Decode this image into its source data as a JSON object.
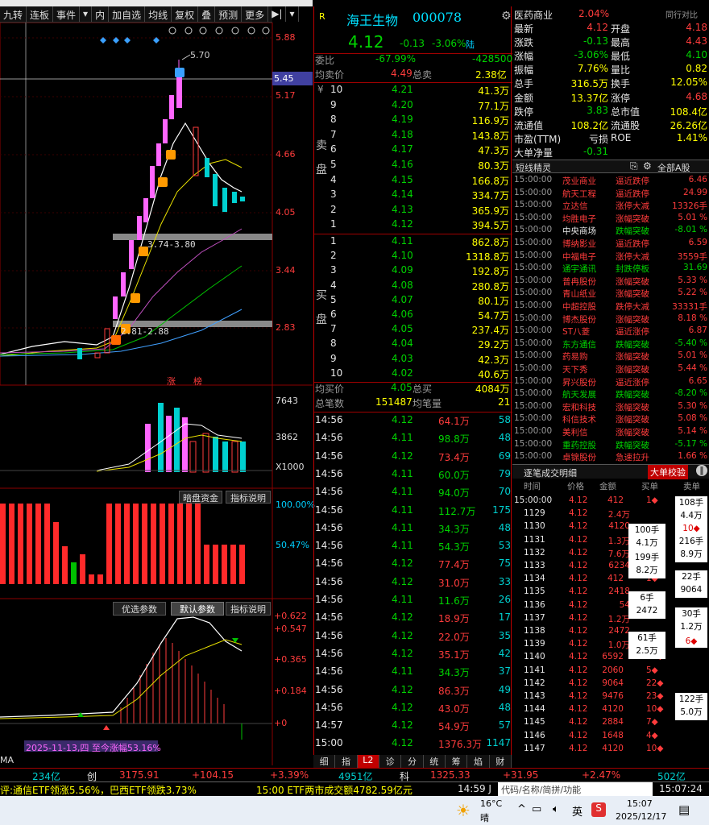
{
  "toolbar": {
    "items": [
      "九转",
      "连板",
      "事件",
      "▾",
      "内",
      "加自选",
      "均线",
      "复权",
      "叠",
      "预测",
      "更多",
      "▶|",
      "▾"
    ]
  },
  "chart": {
    "price_labels": [
      "5.88",
      "5.45",
      "5.17",
      "4.66",
      "4.05",
      "3.44",
      "2.83"
    ],
    "hi_marker": "5.70",
    "box1": "3.74-3.80",
    "box2": "2.81-2.88",
    "zt_labels": [
      "涨",
      "榜"
    ],
    "vol_labels": [
      "7643",
      "3862",
      "X1000"
    ],
    "panel2_buttons": [
      "暗盘资金",
      "指标说明"
    ],
    "panel2_labels": [
      "100.00%",
      "50.47%"
    ],
    "panel3_buttons": [
      "优选参数",
      "默认参数",
      "指标说明"
    ],
    "panel3_labels": [
      "+0.622",
      "+0.547",
      "+0.365",
      "+0.184",
      "+0"
    ],
    "period_note": "2025-11-13,四 至今涨幅53.16%",
    "ma_label": "MA"
  },
  "quote": {
    "r_badge": "R",
    "name": "海王生物",
    "code": "000078",
    "price": "4.12",
    "chg": "-0.13",
    "pct": "-3.06%",
    "lu": "陆",
    "weibi_label": "委比",
    "weibi": "-67.99%",
    "weicha": "-428500",
    "avg_sell_label": "均卖价",
    "avg_sell": "4.49",
    "total_sell_label": "总卖",
    "total_sell": "2.38亿",
    "sell_side": "卖盘",
    "buy_side": "买盘",
    "yen": "¥",
    "sells": [
      {
        "n": "10",
        "p": "4.21",
        "v": "41.3万"
      },
      {
        "n": "9",
        "p": "4.20",
        "v": "77.1万"
      },
      {
        "n": "8",
        "p": "4.19",
        "v": "116.9万"
      },
      {
        "n": "7",
        "p": "4.18",
        "v": "143.8万"
      },
      {
        "n": "6",
        "p": "4.17",
        "v": "47.3万"
      },
      {
        "n": "5",
        "p": "4.16",
        "v": "80.3万"
      },
      {
        "n": "4",
        "p": "4.15",
        "v": "166.8万"
      },
      {
        "n": "3",
        "p": "4.14",
        "v": "334.7万"
      },
      {
        "n": "2",
        "p": "4.13",
        "v": "365.9万"
      },
      {
        "n": "1",
        "p": "4.12",
        "v": "394.5万"
      }
    ],
    "buys": [
      {
        "n": "1",
        "p": "4.11",
        "v": "862.8万"
      },
      {
        "n": "2",
        "p": "4.10",
        "v": "1318.8万"
      },
      {
        "n": "3",
        "p": "4.09",
        "v": "192.8万"
      },
      {
        "n": "4",
        "p": "4.08",
        "v": "280.8万"
      },
      {
        "n": "5",
        "p": "4.07",
        "v": "80.1万"
      },
      {
        "n": "6",
        "p": "4.06",
        "v": "54.7万"
      },
      {
        "n": "7",
        "p": "4.05",
        "v": "237.4万"
      },
      {
        "n": "8",
        "p": "4.04",
        "v": "29.2万"
      },
      {
        "n": "9",
        "p": "4.03",
        "v": "42.3万"
      },
      {
        "n": "10",
        "p": "4.02",
        "v": "40.6万"
      }
    ],
    "avg_buy_label": "均买价",
    "avg_buy": "4.05",
    "total_buy_label": "总买",
    "total_buy": "4084万",
    "total_count_label": "总笔数",
    "total_count": "151487",
    "avg_vol_label": "均笔量",
    "avg_vol": "21",
    "ticks": [
      {
        "t": "14:56",
        "p": "4.12",
        "a": "64.1万",
        "n": "58"
      },
      {
        "t": "14:56",
        "p": "4.11",
        "a": "98.8万",
        "n": "48"
      },
      {
        "t": "14:56",
        "p": "4.12",
        "a": "73.4万",
        "n": "69"
      },
      {
        "t": "14:56",
        "p": "4.11",
        "a": "60.0万",
        "n": "79"
      },
      {
        "t": "14:56",
        "p": "4.11",
        "a": "94.0万",
        "n": "70"
      },
      {
        "t": "14:56",
        "p": "4.11",
        "a": "112.7万",
        "n": "175"
      },
      {
        "t": "14:56",
        "p": "4.11",
        "a": "34.3万",
        "n": "48"
      },
      {
        "t": "14:56",
        "p": "4.11",
        "a": "54.3万",
        "n": "53"
      },
      {
        "t": "14:56",
        "p": "4.12",
        "a": "77.4万",
        "n": "75"
      },
      {
        "t": "14:56",
        "p": "4.12",
        "a": "31.0万",
        "n": "33"
      },
      {
        "t": "14:56",
        "p": "4.11",
        "a": "11.6万",
        "n": "26"
      },
      {
        "t": "14:56",
        "p": "4.12",
        "a": "18.9万",
        "n": "17"
      },
      {
        "t": "14:56",
        "p": "4.12",
        "a": "22.0万",
        "n": "35"
      },
      {
        "t": "14:56",
        "p": "4.12",
        "a": "35.1万",
        "n": "42"
      },
      {
        "t": "14:56",
        "p": "4.11",
        "a": "34.3万",
        "n": "37"
      },
      {
        "t": "14:56",
        "p": "4.12",
        "a": "86.3万",
        "n": "49"
      },
      {
        "t": "14:56",
        "p": "4.12",
        "a": "43.0万",
        "n": "48"
      },
      {
        "t": "14:57",
        "p": "4.12",
        "a": "54.9万",
        "n": "57"
      },
      {
        "t": "15:00",
        "p": "4.12",
        "a": "1376.3万",
        "n": "1147"
      }
    ],
    "tabs": [
      "细",
      "指",
      "L2",
      "诊",
      "分",
      "统",
      "筹",
      "焰",
      "财"
    ]
  },
  "right": {
    "sector": "医药商业",
    "sector_pct": "2.04%",
    "compare_btn": "同行对比",
    "stats": [
      {
        "l1": "最新",
        "v1": "4.12",
        "c1": "red",
        "l2": "开盘",
        "v2": "4.18",
        "c2": "red"
      },
      {
        "l1": "涨跌",
        "v1": "-0.13",
        "c1": "grn",
        "l2": "最高",
        "v2": "4.43",
        "c2": "red"
      },
      {
        "l1": "涨幅",
        "v1": "-3.06%",
        "c1": "grn",
        "l2": "最低",
        "v2": "4.10",
        "c2": "grn"
      },
      {
        "l1": "振幅",
        "v1": "7.76%",
        "c1": "yel",
        "l2": "量比",
        "v2": "0.82",
        "c2": "yel"
      },
      {
        "l1": "总手",
        "v1": "316.5万",
        "c1": "yel",
        "l2": "换手",
        "v2": "12.05%",
        "c2": "yel"
      },
      {
        "l1": "金额",
        "v1": "13.37亿",
        "c1": "yel",
        "l2": "涨停",
        "v2": "4.68",
        "c2": "red"
      },
      {
        "l1": "跌停",
        "v1": "3.83",
        "c1": "grn",
        "l2": "总市值",
        "v2": "108.4亿",
        "c2": "yel"
      },
      {
        "l1": "流通值",
        "v1": "108.2亿",
        "c1": "yel",
        "l2": "流通股",
        "v2": "26.26亿",
        "c2": "yel"
      },
      {
        "l1": "市盈(TTM)",
        "v1": "亏损",
        "c1": "wht",
        "l2": "ROE",
        "v2": "1.41%",
        "c2": "yel"
      },
      {
        "l1": "大单净量",
        "v1": "-0.31",
        "c1": "grn",
        "l2": "",
        "v2": "",
        "c2": "yel"
      }
    ],
    "fl_title": "短线精灵",
    "fl_scope": "全部A股",
    "flashes": [
      {
        "t": "15:00:00",
        "n": "茂业商业",
        "e": "逼近跌停",
        "v": "6.46",
        "c": "red"
      },
      {
        "t": "15:00:00",
        "n": "航天工程",
        "e": "逼近跌停",
        "v": "24.99",
        "c": "red"
      },
      {
        "t": "15:00:00",
        "n": "立达信",
        "e": "涨停大减",
        "v": "13326手",
        "c": "red"
      },
      {
        "t": "15:00:00",
        "n": "均胜电子",
        "e": "涨幅突破",
        "v": "5.01 %",
        "c": "red"
      },
      {
        "t": "15:00:00",
        "n": "中央商场",
        "e": "跌幅突破",
        "v": "-8.01 %",
        "c": "grn"
      },
      {
        "t": "15:00:00",
        "n": "博纳影业",
        "e": "逼近跌停",
        "v": "6.59",
        "c": "red"
      },
      {
        "t": "15:00:00",
        "n": "中福电子",
        "e": "涨停大减",
        "v": "3559手",
        "c": "red"
      },
      {
        "t": "15:00:00",
        "n": "通宇通讯",
        "e": "封跌停板",
        "v": "31.69",
        "c": "grn"
      },
      {
        "t": "15:00:00",
        "n": "普冉股份",
        "e": "涨幅突破",
        "v": "5.33 %",
        "c": "red"
      },
      {
        "t": "15:00:00",
        "n": "青山纸业",
        "e": "涨幅突破",
        "v": "5.22 %",
        "c": "red"
      },
      {
        "t": "15:00:00",
        "n": "中超控股",
        "e": "跌停大减",
        "v": "33331手",
        "c": "red"
      },
      {
        "t": "15:00:00",
        "n": "博杰股份",
        "e": "涨幅突破",
        "v": "8.18 %",
        "c": "red"
      },
      {
        "t": "15:00:00",
        "n": "ST八菱",
        "e": "逼近涨停",
        "v": "6.87",
        "c": "red"
      },
      {
        "t": "15:00:00",
        "n": "东方通信",
        "e": "跌幅突破",
        "v": "-5.40 %",
        "c": "grn"
      },
      {
        "t": "15:00:00",
        "n": "药易购",
        "e": "涨幅突破",
        "v": "5.01 %",
        "c": "red"
      },
      {
        "t": "15:00:00",
        "n": "天下秀",
        "e": "涨幅突破",
        "v": "5.44 %",
        "c": "red"
      },
      {
        "t": "15:00:00",
        "n": "昇兴股份",
        "e": "逼近涨停",
        "v": "6.65",
        "c": "red"
      },
      {
        "t": "15:00:00",
        "n": "航天发展",
        "e": "跌幅突破",
        "v": "-8.20 %",
        "c": "grn"
      },
      {
        "t": "15:00:00",
        "n": "宏和科技",
        "e": "涨幅突破",
        "v": "5.30 %",
        "c": "red"
      },
      {
        "t": "15:00:00",
        "n": "科信技术",
        "e": "涨幅突破",
        "v": "5.08 %",
        "c": "red"
      },
      {
        "t": "15:00:00",
        "n": "美利信",
        "e": "涨幅突破",
        "v": "5.14 %",
        "c": "red"
      },
      {
        "t": "15:00:00",
        "n": "重药控股",
        "e": "跌幅突破",
        "v": "-5.17 %",
        "c": "grn"
      },
      {
        "t": "15:00:00",
        "n": "卓锦股份",
        "e": "急速拉升",
        "v": "1.66 %",
        "c": "red"
      }
    ],
    "dt_title": "逐笔成交明细",
    "dt_btn": "大单校验",
    "dt_headers": [
      "时间",
      "价格",
      "金额",
      "买单",
      "卖单"
    ],
    "deals": [
      {
        "t": "15:00:00",
        "p": "4.12",
        "a": "412",
        "b": "1◆",
        "s": ""
      },
      {
        "t": "1129",
        "p": "4.12",
        "a": "2.4万",
        "b": "",
        "s": ""
      },
      {
        "t": "1130",
        "p": "4.12",
        "a": "4120",
        "b": "",
        "s": ""
      },
      {
        "t": "1131",
        "p": "4.12",
        "a": "1.3万",
        "b": "",
        "s": ""
      },
      {
        "t": "1132",
        "p": "4.12",
        "a": "7.6万",
        "b": "",
        "s": ""
      },
      {
        "t": "1133",
        "p": "4.12",
        "a": "6234",
        "b": "",
        "s": ""
      },
      {
        "t": "1134",
        "p": "4.12",
        "a": "412",
        "b": "1◆",
        "s": ""
      },
      {
        "t": "1135",
        "p": "4.12",
        "a": "2418",
        "b": "",
        "s": ""
      },
      {
        "t": "1136",
        "p": "4.12",
        "a": "54",
        "b": "",
        "s": ""
      },
      {
        "t": "1137",
        "p": "4.12",
        "a": "1.2万",
        "b": "",
        "s": ""
      },
      {
        "t": "1138",
        "p": "4.12",
        "a": "2472",
        "b": "",
        "s": ""
      },
      {
        "t": "1139",
        "p": "4.12",
        "a": "1.0万",
        "b": "",
        "s": ""
      },
      {
        "t": "1140",
        "p": "4.12",
        "a": "6592",
        "b": "16◆",
        "s": ""
      },
      {
        "t": "1141",
        "p": "4.12",
        "a": "2060",
        "b": "5◆",
        "s": ""
      },
      {
        "t": "1142",
        "p": "4.12",
        "a": "9064",
        "b": "22◆",
        "s": ""
      },
      {
        "t": "1143",
        "p": "4.12",
        "a": "9476",
        "b": "23◆",
        "s": ""
      },
      {
        "t": "1144",
        "p": "4.12",
        "a": "4120",
        "b": "10◆",
        "s": ""
      },
      {
        "t": "1145",
        "p": "4.12",
        "a": "2884",
        "b": "7◆",
        "s": ""
      },
      {
        "t": "1146",
        "p": "4.12",
        "a": "1648",
        "b": "4◆",
        "s": ""
      },
      {
        "t": "1147",
        "p": "4.12",
        "a": "4120",
        "b": "10◆",
        "s": ""
      }
    ],
    "buy_boxes": [
      [
        "100手",
        "4.1万"
      ],
      [
        "199手",
        "8.2万"
      ],
      [
        "6手",
        "2472"
      ],
      [
        "61手",
        "2.5万"
      ]
    ],
    "sell_boxes": [
      [
        "108手",
        "4.4万"
      ],
      [
        "10◆",
        ""
      ],
      [
        "216手",
        "8.9万"
      ],
      [
        "22手",
        "9064"
      ],
      [
        "30手",
        "1.2万"
      ],
      [
        "6◆",
        ""
      ],
      [
        "122手",
        "5.0万"
      ]
    ]
  },
  "status1": {
    "a": "234亿",
    "b": "创",
    "c": "3175.91",
    "d": "+104.15",
    "e": "+3.39%",
    "f": "4951亿",
    "g": "科",
    "h": "1325.33",
    "i": "+31.95",
    "j": "+2.47%",
    "k": "502亿"
  },
  "status2": {
    "ticker": "评:通信ETF领涨5.56%，巴西ETF领跌3.73%",
    "ticker2": "15:00 ETF两市成交额4782.59亿元",
    "time": "14:59 J",
    "search": "代码/名称/简拼/功能",
    "clock": "15:07:24"
  },
  "taskbar": {
    "temp": "16°C",
    "weather": "晴",
    "lang": "英",
    "time": "15:07",
    "date": "2025/12/17"
  }
}
